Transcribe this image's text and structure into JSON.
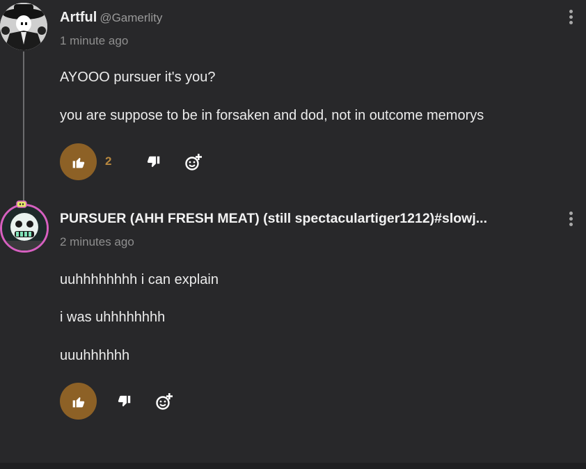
{
  "comments": [
    {
      "author": "Artful",
      "handle": "@Gamerlity",
      "time": "1 minute ago",
      "lines": [
        "AYOOO pursuer it's you?",
        "you are suppose to be in forsaken and dod, not in outcome memorys"
      ],
      "like_count": "2",
      "avatar_icon": "artful-avatar"
    },
    {
      "author": "PURSUER (AHH FRESH MEAT) (still spectaculartiger1212)#slowj...",
      "time": "2 minutes ago",
      "lines": [
        "uuhhhhhhhh i can explain",
        "i was uhhhhhhhh",
        "uuuhhhhhh"
      ],
      "avatar_icon": "pursuer-avatar"
    }
  ],
  "icons": {
    "like": "thumbs-up-icon",
    "dislike": "thumbs-down-icon",
    "react": "add-reaction-icon",
    "menu": "more-vertical-icon"
  },
  "colors": {
    "background": "#28282a",
    "like_button": "#8d6126",
    "like_count": "#b8883f",
    "text": "#ececec",
    "muted": "#8f8f8f"
  }
}
